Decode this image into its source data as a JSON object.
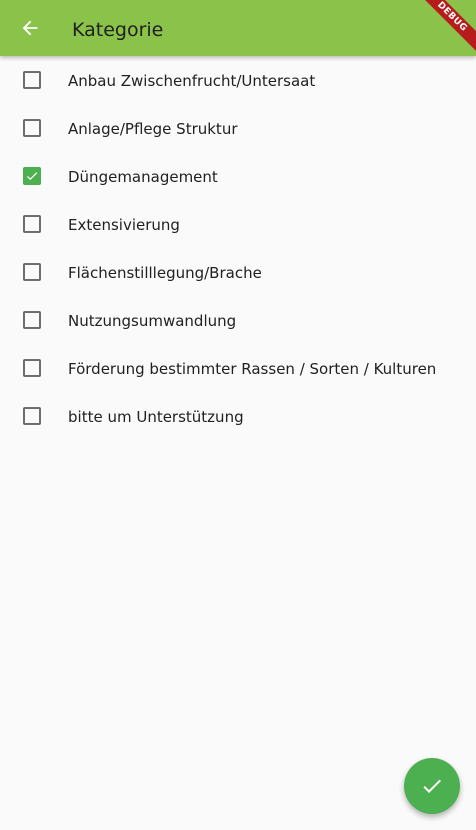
{
  "appbar": {
    "title": "Kategorie",
    "back_icon": "arrow-back-icon",
    "debug_banner": "DEBUG",
    "color": "#8bc34a"
  },
  "categories": [
    {
      "label": "Anbau Zwischenfrucht/Untersaat",
      "checked": false
    },
    {
      "label": "Anlage/Pflege Struktur",
      "checked": false
    },
    {
      "label": "Düngemanagement",
      "checked": true
    },
    {
      "label": "Extensivierung",
      "checked": false
    },
    {
      "label": "Flächenstilllegung/Brache",
      "checked": false
    },
    {
      "label": "Nutzungsumwandlung",
      "checked": false
    },
    {
      "label": "Förderung bestimmter Rassen / Sorten / Kulturen",
      "checked": false
    },
    {
      "label": "bitte um Unterstützung",
      "checked": false
    }
  ],
  "fab": {
    "icon": "check-icon",
    "color": "#4caf50"
  }
}
